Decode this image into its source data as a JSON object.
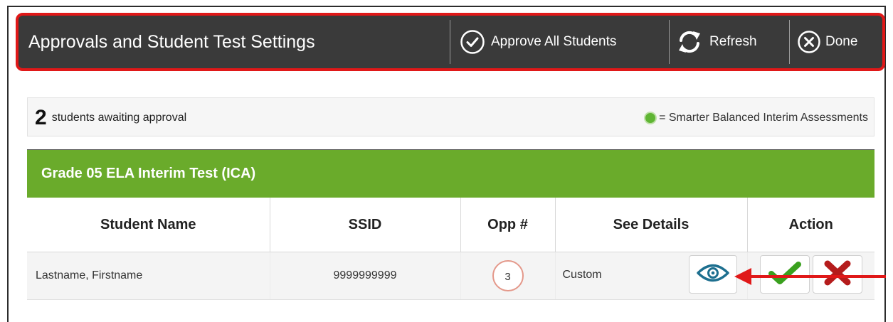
{
  "header": {
    "title": "Approvals and Student Test Settings",
    "approve_all_label": "Approve All Students",
    "refresh_label": "Refresh",
    "done_label": "Done"
  },
  "summary": {
    "count": "2",
    "count_text": "students awaiting approval",
    "legend_text": "= Smarter Balanced Interim Assessments"
  },
  "test": {
    "name": "Grade 05 ELA Interim Test (ICA)"
  },
  "table": {
    "columns": [
      "Student Name",
      "SSID",
      "Opp #",
      "See Details",
      "Action"
    ],
    "rows": [
      {
        "student_name": "Lastname, Firstname",
        "ssid": "9999999999",
        "opp": "3",
        "details": "Custom"
      }
    ]
  },
  "colors": {
    "header_bg": "#3a3a3a",
    "highlight_border": "#e01818",
    "grade_bar": "#6aab2b",
    "approve_check": "#3aa01e",
    "deny_x": "#b51c1c",
    "eye_icon": "#1d6f8f",
    "arrow": "#e01818"
  },
  "icons": {
    "approve_all": "check-circle-icon",
    "refresh": "refresh-icon",
    "done": "close-circle-icon",
    "details": "eye-icon",
    "approve": "checkmark-icon",
    "deny": "x-icon"
  }
}
